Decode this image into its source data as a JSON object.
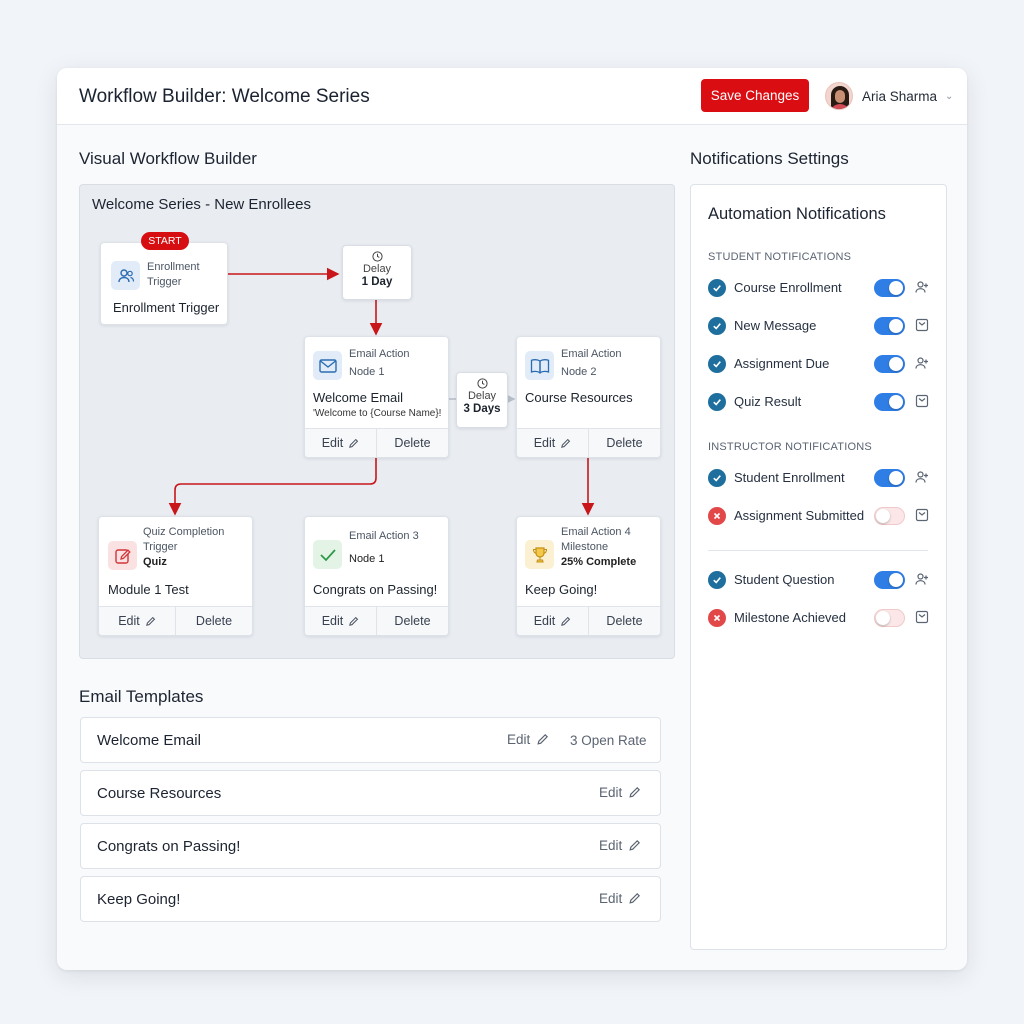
{
  "header": {
    "title": "Workflow Builder: Welcome Series",
    "save_label": "Save Changes",
    "user_name": "Aria Sharma",
    "user_caret": "⌄"
  },
  "builder": {
    "section_title": "Visual Workflow Builder",
    "canvas_title": "Welcome Series - New Enrollees",
    "start_badge": "START",
    "trigger": {
      "type": "Enrollment",
      "type_line2": "Trigger",
      "title": "Enrollment Trigger",
      "icon": "users-icon"
    },
    "delay1": {
      "label": "Delay",
      "value": "1 Day"
    },
    "delay2": {
      "label": "Delay",
      "value": "3 Days"
    },
    "node1": {
      "kind": "Email Action",
      "node": "Node 1",
      "title": "Welcome Email",
      "snippet": "'Welcome to {Course Name}!",
      "icon": "mail-icon",
      "edit": "Edit",
      "delete": "Delete"
    },
    "node2": {
      "kind": "Email Action",
      "node": "Node 2",
      "title": "Course Resources",
      "icon": "book-icon",
      "edit": "Edit",
      "delete": "Delete"
    },
    "quiz": {
      "kind": "Quiz Completion",
      "kind_line2": "Trigger",
      "sub": "Quiz",
      "title": "Module 1 Test",
      "icon": "edit-icon",
      "edit": "Edit",
      "delete": "Delete"
    },
    "node3": {
      "kind": "Email Action 3",
      "node": "Node 1",
      "title": "Congrats on Passing!",
      "icon": "check-icon",
      "edit": "Edit",
      "delete": "Delete"
    },
    "node4": {
      "kind": "Email Action 4",
      "kind_line2": "Milestone",
      "sub": "25% Complete",
      "title": "Keep Going!",
      "icon": "trophy-icon",
      "edit": "Edit",
      "delete": "Delete"
    }
  },
  "templates": {
    "section_title": "Email Templates",
    "items": [
      {
        "name": "Welcome Email",
        "edit": "Edit",
        "rate": "3 Open Rate"
      },
      {
        "name": "Course Resources",
        "edit": "Edit"
      },
      {
        "name": "Congrats on Passing!",
        "edit": "Edit"
      },
      {
        "name": "Keep Going!",
        "edit": "Edit"
      }
    ]
  },
  "notifications": {
    "section_title": "Notifications Settings",
    "panel_title": "Automation Notifications",
    "student_label": "STUDENT NOTIFICATIONS",
    "instructor_label": "INSTRUCTOR NOTIFICATIONS",
    "student": [
      {
        "label": "Course Enrollment",
        "status": "ok",
        "enabled": true,
        "icon": "user-plus-icon"
      },
      {
        "label": "New Message",
        "status": "ok",
        "enabled": true,
        "icon": "inbox-icon"
      },
      {
        "label": "Assignment Due",
        "status": "ok",
        "enabled": true,
        "icon": "user-plus-icon"
      },
      {
        "label": "Quiz Result",
        "status": "ok",
        "enabled": true,
        "icon": "inbox-icon"
      }
    ],
    "instructor": [
      {
        "label": "Student Enrollment",
        "status": "ok",
        "enabled": true,
        "icon": "user-plus-icon"
      },
      {
        "label": "Assignment Submitted",
        "status": "error",
        "enabled": false,
        "icon": "inbox-icon"
      }
    ],
    "other": [
      {
        "label": "Student Question",
        "status": "ok",
        "enabled": true,
        "icon": "user-plus-icon"
      },
      {
        "label": "Milestone Achieved",
        "status": "error",
        "enabled": false,
        "icon": "inbox-icon"
      }
    ]
  },
  "colors": {
    "accent_red": "#d90d12",
    "toggle_on": "#2f7ee6",
    "status_ok": "#1f6f9e",
    "status_error": "#e24848",
    "wire": "#c8161b"
  }
}
